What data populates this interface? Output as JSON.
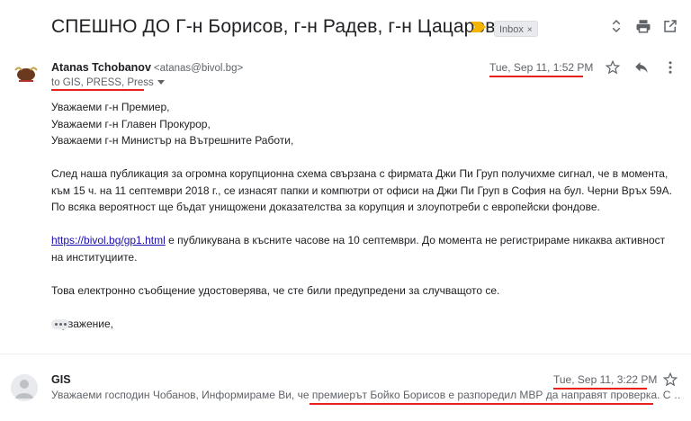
{
  "thread": {
    "subject": "СПЕШНО ДО Г-н Борисов, г-н Радев, г-н Цацаров",
    "label": "Inbox",
    "label_remove": "×"
  },
  "header_icons": [
    "unfold-icon",
    "print-icon",
    "open-in-new-icon"
  ],
  "message1": {
    "sender_name": "Atanas Tchobanov",
    "sender_email": "<atanas@bivol.bg>",
    "recipients": "to GIS, PRESS, Press",
    "date": "Tue, Sep 11, 1:52 PM",
    "body": {
      "greeting1": "Уважаеми г-н Премиер,",
      "greeting2": "Уважаеми г-н Главен Прокурор,",
      "greeting3": "Уважаеми г-н Министър на Вътрешните Работи,",
      "para1": "След наша публикация за огромна корупционна схема свързана с фирмата Джи Пи Груп получихме сигнал, че в момента, към 15 ч. на 11 септември 2018 г., се изнасят папки и компютри от офиси на Джи Пи Груп в София на бул. Черни Връх 59А. По всяка вероятност ще бъдат унищожени доказателства за корупция и злоупотреби с европейски фондове.",
      "link": "https://bivol.bg/gp1.html",
      "para2_rest": " е публикувана в късните часове на 10 септември. До момента не регистрираме никаква активност на институциите.",
      "para3": "Това електронно съобщение удостоверява, че сте били предупредени за случващото се.",
      "closing": "С уважение,"
    }
  },
  "message2": {
    "sender_name": "GIS",
    "date": "Tue, Sep 11, 3:22 PM",
    "snippet_start": "Уважаеми господин Чобанов, Информираме Ви, че ",
    "snippet_highlight": "премиерът Бойко Борисов е разпоредил МВР да направят проверка",
    "snippet_end": ". С …"
  },
  "colors": {
    "underline": "#e8211c",
    "link": "#1a0dab",
    "importance": "#f4b400"
  }
}
